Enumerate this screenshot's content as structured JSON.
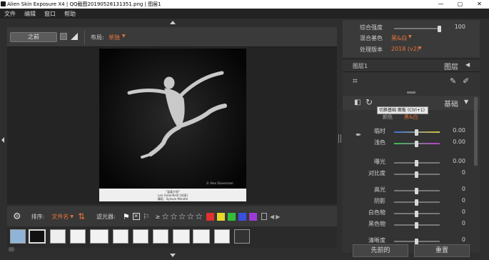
{
  "window": {
    "title": "Alien Skin Exposure X4 | QQ截图20190528131351.png | 图层1",
    "minimize": "—",
    "maximize": "▢",
    "close": "✕"
  },
  "menu": [
    "文件",
    "编辑",
    "窗口",
    "帮助"
  ],
  "toolbar": {
    "before_label": "之前",
    "layout_label": "布局:",
    "layout_value": "单独"
  },
  "photo": {
    "watermark": "© Alex Stavenman",
    "caption_line1": "\"温柔夕阳\"",
    "caption_line2": "Len Greenfield [刘瑶]",
    "caption_line3": "舞蹈 · Sylvain Mendel"
  },
  "filter_bar": {
    "sort_label": "排序:",
    "sort_value": "文件名",
    "filter_label": "滤光器:",
    "gte": "≥"
  },
  "color_labels": [
    "#e03030",
    "#e8d62a",
    "#2fbf3a",
    "#3a50e0",
    "#9a3ad8"
  ],
  "stars": 5,
  "top_panel": {
    "rows": [
      {
        "label": "综合强度",
        "value": "100",
        "pos": 1.0
      },
      {
        "label": "混合基色",
        "value": "黑&白"
      },
      {
        "label": "处理版本",
        "value": "2018 (v2)"
      }
    ]
  },
  "layers": {
    "name": "图层1",
    "title": "图层"
  },
  "basic": {
    "title": "基础",
    "tooltip": "切换基础 面板 (Ctrl+1)",
    "type_label": "颜色",
    "type_value": "黑&白"
  },
  "sliders": [
    {
      "label": "临时",
      "value": "0.00",
      "kind": "temp",
      "pos": 0.5
    },
    {
      "label": "浅色",
      "value": "0.00",
      "kind": "tint",
      "pos": 0.5
    },
    {
      "label": "曝光",
      "value": "0.00",
      "kind": "gray",
      "pos": 0.5
    },
    {
      "label": "对比度",
      "value": "0",
      "kind": "gray",
      "pos": 0.5
    },
    {
      "label": "高光",
      "value": "0",
      "kind": "gray",
      "pos": 0.5
    },
    {
      "label": "阴影",
      "value": "0",
      "kind": "gray",
      "pos": 0.5
    },
    {
      "label": "白色物",
      "value": "0",
      "kind": "gray",
      "pos": 0.5
    },
    {
      "label": "黑色物",
      "value": "0",
      "kind": "gray",
      "pos": 0.5
    },
    {
      "label": "清晰度",
      "value": "0",
      "kind": "gray",
      "pos": 0.5
    }
  ],
  "bottom": {
    "prev": "先前的",
    "reset": "重置"
  },
  "menu_icons": {
    "gear": "gear-icon",
    "sort": "sort-arrows-icon"
  }
}
